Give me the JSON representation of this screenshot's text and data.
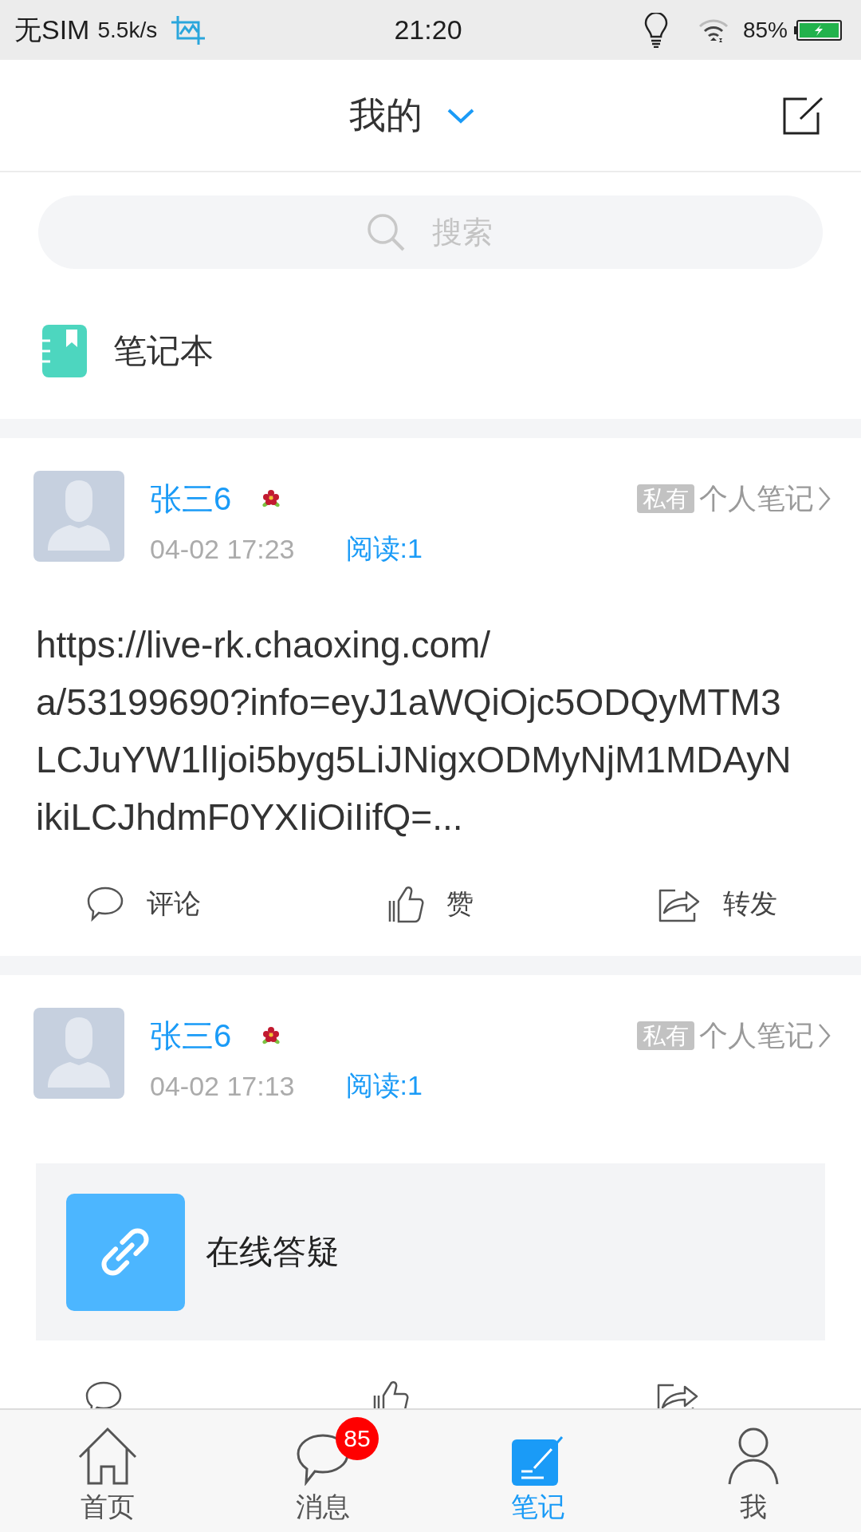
{
  "status_bar": {
    "carrier": "无SIM",
    "speed": "5.5k/s",
    "time": "21:20",
    "battery": "85%"
  },
  "header": {
    "title": "我的"
  },
  "search": {
    "placeholder": "搜索"
  },
  "notebook": {
    "label": "笔记本"
  },
  "posts": [
    {
      "author": "张三6",
      "time": "04-02 17:23",
      "reads": "阅读:1",
      "badge": "私有",
      "category": "个人笔记",
      "content": {
        "kind": "text",
        "lines": [
          "https://live-rk.chaoxing.com/",
          "a/53199690?info=eyJ1aWQiOjc5ODQyMTM3",
          "LCJuYW1lIjoi5byg5LiJNigxODMyNjM1MDAyN",
          "ikiLCJhdmF0YXIiOiIifQ=..."
        ]
      },
      "actions": [
        {
          "kind": "comment",
          "label": "评论"
        },
        {
          "kind": "like",
          "label": "赞"
        },
        {
          "kind": "share",
          "label": "转发"
        }
      ]
    },
    {
      "author": "张三6",
      "time": "04-02 17:13",
      "reads": "阅读:1",
      "badge": "私有",
      "category": "个人笔记",
      "content": {
        "kind": "link",
        "title": "在线答疑"
      },
      "actions": [
        {
          "kind": "comment"
        },
        {
          "kind": "like"
        },
        {
          "kind": "share"
        }
      ]
    }
  ],
  "tab_bar": {
    "items": [
      {
        "kind": "home",
        "label": "首页",
        "selected": false
      },
      {
        "kind": "messages",
        "label": "消息",
        "selected": false,
        "badge": "85"
      },
      {
        "kind": "notes",
        "label": "笔记",
        "selected": true
      },
      {
        "kind": "me",
        "label": "我",
        "selected": false
      }
    ]
  }
}
